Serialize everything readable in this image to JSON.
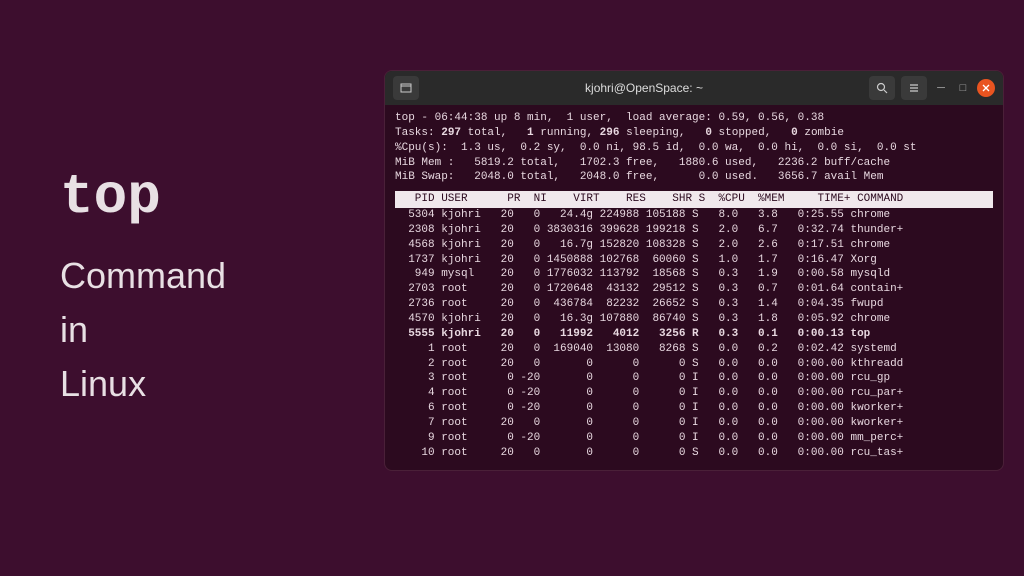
{
  "left": {
    "title": "top",
    "subtitle_line1": "Command",
    "subtitle_line2": "in",
    "subtitle_line3": "Linux"
  },
  "titlebar": {
    "title": "kjohri@OpenSpace: ~"
  },
  "summary": {
    "line1": "top - 06:44:38 up 8 min,  1 user,  load average: 0.59, 0.56, 0.38",
    "line2_pre": "Tasks: ",
    "line2_total": "297",
    "line2_mid1": " total,   ",
    "line2_run": "1",
    "line2_mid2": " running, ",
    "line2_sleep": "296",
    "line2_mid3": " sleeping,   ",
    "line2_stop": "0",
    "line2_mid4": " stopped,   ",
    "line2_zombie": "0",
    "line2_end": " zombie",
    "line3": "%Cpu(s):  1.3 us,  0.2 sy,  0.0 ni, 98.5 id,  0.0 wa,  0.0 hi,  0.0 si,  0.0 st",
    "line4": "MiB Mem :   5819.2 total,   1702.3 free,   1880.6 used,   2236.2 buff/cache",
    "line5": "MiB Swap:   2048.0 total,   2048.0 free,      0.0 used.   3656.7 avail Mem"
  },
  "header": "   PID USER      PR  NI    VIRT    RES    SHR S  %CPU  %MEM     TIME+ COMMAND",
  "processes": [
    {
      "pid": "5304",
      "user": "kjohri",
      "pr": "20",
      "ni": "0",
      "virt": "24.4g",
      "res": "224988",
      "shr": "105188",
      "s": "S",
      "cpu": "8.0",
      "mem": "3.8",
      "time": "0:25.55",
      "cmd": "chrome",
      "bold": false
    },
    {
      "pid": "2308",
      "user": "kjohri",
      "pr": "20",
      "ni": "0",
      "virt": "3830316",
      "res": "399628",
      "shr": "199218",
      "s": "S",
      "cpu": "2.0",
      "mem": "6.7",
      "time": "0:32.74",
      "cmd": "thunder+",
      "bold": false
    },
    {
      "pid": "4568",
      "user": "kjohri",
      "pr": "20",
      "ni": "0",
      "virt": "16.7g",
      "res": "152820",
      "shr": "108328",
      "s": "S",
      "cpu": "2.0",
      "mem": "2.6",
      "time": "0:17.51",
      "cmd": "chrome",
      "bold": false
    },
    {
      "pid": "1737",
      "user": "kjohri",
      "pr": "20",
      "ni": "0",
      "virt": "1450888",
      "res": "102768",
      "shr": "60060",
      "s": "S",
      "cpu": "1.0",
      "mem": "1.7",
      "time": "0:16.47",
      "cmd": "Xorg",
      "bold": false
    },
    {
      "pid": "949",
      "user": "mysql",
      "pr": "20",
      "ni": "0",
      "virt": "1776032",
      "res": "113792",
      "shr": "18568",
      "s": "S",
      "cpu": "0.3",
      "mem": "1.9",
      "time": "0:00.58",
      "cmd": "mysqld",
      "bold": false
    },
    {
      "pid": "2703",
      "user": "root",
      "pr": "20",
      "ni": "0",
      "virt": "1720648",
      "res": "43132",
      "shr": "29512",
      "s": "S",
      "cpu": "0.3",
      "mem": "0.7",
      "time": "0:01.64",
      "cmd": "contain+",
      "bold": false
    },
    {
      "pid": "2736",
      "user": "root",
      "pr": "20",
      "ni": "0",
      "virt": "436784",
      "res": "82232",
      "shr": "26652",
      "s": "S",
      "cpu": "0.3",
      "mem": "1.4",
      "time": "0:04.35",
      "cmd": "fwupd",
      "bold": false
    },
    {
      "pid": "4570",
      "user": "kjohri",
      "pr": "20",
      "ni": "0",
      "virt": "16.3g",
      "res": "107880",
      "shr": "86740",
      "s": "S",
      "cpu": "0.3",
      "mem": "1.8",
      "time": "0:05.92",
      "cmd": "chrome",
      "bold": false
    },
    {
      "pid": "5555",
      "user": "kjohri",
      "pr": "20",
      "ni": "0",
      "virt": "11992",
      "res": "4012",
      "shr": "3256",
      "s": "R",
      "cpu": "0.3",
      "mem": "0.1",
      "time": "0:00.13",
      "cmd": "top",
      "bold": true
    },
    {
      "pid": "1",
      "user": "root",
      "pr": "20",
      "ni": "0",
      "virt": "169040",
      "res": "13080",
      "shr": "8268",
      "s": "S",
      "cpu": "0.0",
      "mem": "0.2",
      "time": "0:02.42",
      "cmd": "systemd",
      "bold": false
    },
    {
      "pid": "2",
      "user": "root",
      "pr": "20",
      "ni": "0",
      "virt": "0",
      "res": "0",
      "shr": "0",
      "s": "S",
      "cpu": "0.0",
      "mem": "0.0",
      "time": "0:00.00",
      "cmd": "kthreadd",
      "bold": false
    },
    {
      "pid": "3",
      "user": "root",
      "pr": "0",
      "ni": "-20",
      "virt": "0",
      "res": "0",
      "shr": "0",
      "s": "I",
      "cpu": "0.0",
      "mem": "0.0",
      "time": "0:00.00",
      "cmd": "rcu_gp",
      "bold": false
    },
    {
      "pid": "4",
      "user": "root",
      "pr": "0",
      "ni": "-20",
      "virt": "0",
      "res": "0",
      "shr": "0",
      "s": "I",
      "cpu": "0.0",
      "mem": "0.0",
      "time": "0:00.00",
      "cmd": "rcu_par+",
      "bold": false
    },
    {
      "pid": "6",
      "user": "root",
      "pr": "0",
      "ni": "-20",
      "virt": "0",
      "res": "0",
      "shr": "0",
      "s": "I",
      "cpu": "0.0",
      "mem": "0.0",
      "time": "0:00.00",
      "cmd": "kworker+",
      "bold": false
    },
    {
      "pid": "7",
      "user": "root",
      "pr": "20",
      "ni": "0",
      "virt": "0",
      "res": "0",
      "shr": "0",
      "s": "I",
      "cpu": "0.0",
      "mem": "0.0",
      "time": "0:00.00",
      "cmd": "kworker+",
      "bold": false
    },
    {
      "pid": "9",
      "user": "root",
      "pr": "0",
      "ni": "-20",
      "virt": "0",
      "res": "0",
      "shr": "0",
      "s": "I",
      "cpu": "0.0",
      "mem": "0.0",
      "time": "0:00.00",
      "cmd": "mm_perc+",
      "bold": false
    },
    {
      "pid": "10",
      "user": "root",
      "pr": "20",
      "ni": "0",
      "virt": "0",
      "res": "0",
      "shr": "0",
      "s": "S",
      "cpu": "0.0",
      "mem": "0.0",
      "time": "0:00.00",
      "cmd": "rcu_tas+",
      "bold": false
    }
  ]
}
